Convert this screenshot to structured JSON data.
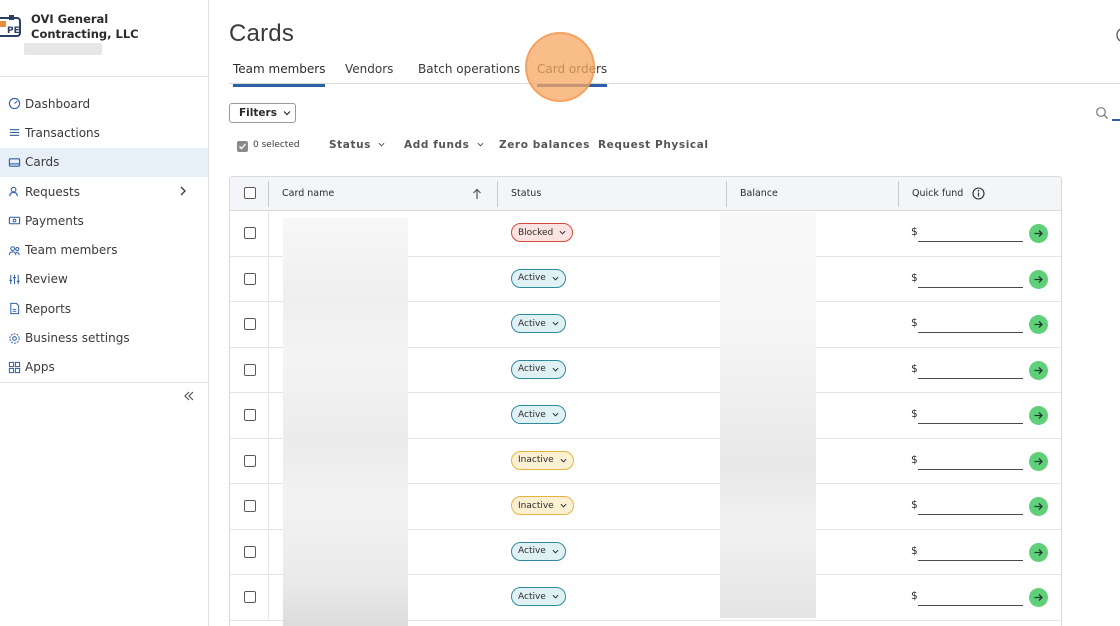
{
  "org": {
    "name": "OVI General Contracting, LLC"
  },
  "sidebar": {
    "items": [
      {
        "label": "Dashboard",
        "icon": "dashboard-icon",
        "active": false
      },
      {
        "label": "Transactions",
        "icon": "list-icon",
        "active": false
      },
      {
        "label": "Cards",
        "icon": "card-icon",
        "active": true
      },
      {
        "label": "Requests",
        "icon": "request-icon",
        "active": false,
        "expandable": true
      },
      {
        "label": "Payments",
        "icon": "payment-icon",
        "active": false
      },
      {
        "label": "Team members",
        "icon": "team-icon",
        "active": false
      },
      {
        "label": "Review",
        "icon": "sliders-icon",
        "active": false
      },
      {
        "label": "Reports",
        "icon": "report-icon",
        "active": false
      },
      {
        "label": "Business settings",
        "icon": "gear-icon",
        "active": false
      },
      {
        "label": "Apps",
        "icon": "apps-icon",
        "active": false
      }
    ]
  },
  "page": {
    "title": "Cards"
  },
  "tabs": [
    {
      "label": "Team members",
      "active": true
    },
    {
      "label": "Vendors",
      "active": false
    },
    {
      "label": "Batch operations",
      "active": false
    },
    {
      "label": "Card orders",
      "active": false
    }
  ],
  "filters": {
    "label": "Filters"
  },
  "toolbar": {
    "selected_text": "0 selected",
    "status_label": "Status",
    "add_funds_label": "Add funds",
    "zero_balances_label": "Zero balances",
    "request_physical_label": "Request Physical"
  },
  "table": {
    "headers": {
      "card_name": "Card name",
      "status": "Status",
      "balance": "Balance",
      "quick_fund": "Quick fund"
    },
    "currency_symbol": "$",
    "rows": [
      {
        "status": "Blocked"
      },
      {
        "status": "Active"
      },
      {
        "status": "Active"
      },
      {
        "status": "Active"
      },
      {
        "status": "Active"
      },
      {
        "status": "Inactive"
      },
      {
        "status": "Inactive"
      },
      {
        "status": "Active"
      },
      {
        "status": "Active"
      }
    ]
  },
  "colors": {
    "accent": "#2f5fa6",
    "active_nav_bg": "#e7eff8",
    "blocked": "#d54a3b",
    "active": "#2f8aa0",
    "inactive": "#e4b43f",
    "go_button": "#5fcf7a",
    "highlight": "#f7a762"
  }
}
